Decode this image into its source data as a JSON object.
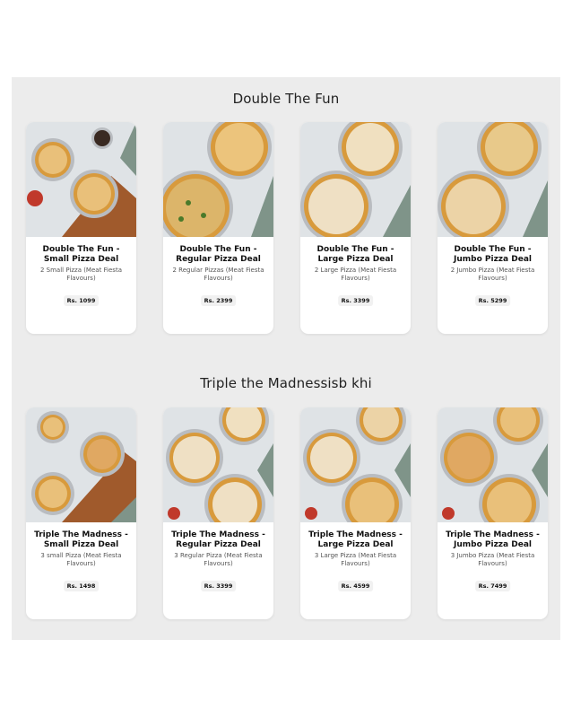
{
  "sections": [
    {
      "title": "Double The Fun",
      "cards": [
        {
          "name": "Double The Fun - Small Pizza Deal",
          "desc": "2 Small Pizza (Meat Fiesta Flavours)",
          "price": "Rs. 1099"
        },
        {
          "name": "Double The Fun - Regular Pizza Deal",
          "desc": "2 Regular Pizzas (Meat Fiesta Flavours)",
          "price": "Rs. 2399"
        },
        {
          "name": "Double The Fun - Large Pizza Deal",
          "desc": "2 Large Pizza (Meat Fiesta Flavours)",
          "price": "Rs. 3399"
        },
        {
          "name": "Double The Fun - Jumbo Pizza Deal",
          "desc": "2 Jumbo Pizza (Meat Fiesta Flavours)",
          "price": "Rs. 5299"
        }
      ]
    },
    {
      "title": "Triple the Madnessisb khi",
      "cards": [
        {
          "name": "Triple The Madness - Small Pizza Deal",
          "desc": "3 small Pizza (Meat Fiesta Flavours)",
          "price": "Rs. 1498"
        },
        {
          "name": "Triple The Madness - Regular Pizza Deal",
          "desc": "3 Regular Pizza (Meat Fiesta Flavours)",
          "price": "Rs. 3399"
        },
        {
          "name": "Triple The Madness - Large Pizza Deal",
          "desc": "3 Large Pizza (Meat Fiesta Flavours)",
          "price": "Rs. 4599"
        },
        {
          "name": "Triple The Madness - Jumbo Pizza Deal",
          "desc": "3 Jumbo Pizza (Meat Fiesta Flavours)",
          "price": "Rs. 7499"
        }
      ]
    }
  ],
  "colors": {
    "panel_bg": "#ececec",
    "card_bg": "#ffffff",
    "marble_bg": "#dfe3e6",
    "pizza_crust": "#d89a3c",
    "pizza_top": "#e9c07a",
    "pan": "#b9bcc0",
    "wood_board": "#a05a2c",
    "sauce": "#c0392b",
    "greenery": "#7f9489"
  }
}
